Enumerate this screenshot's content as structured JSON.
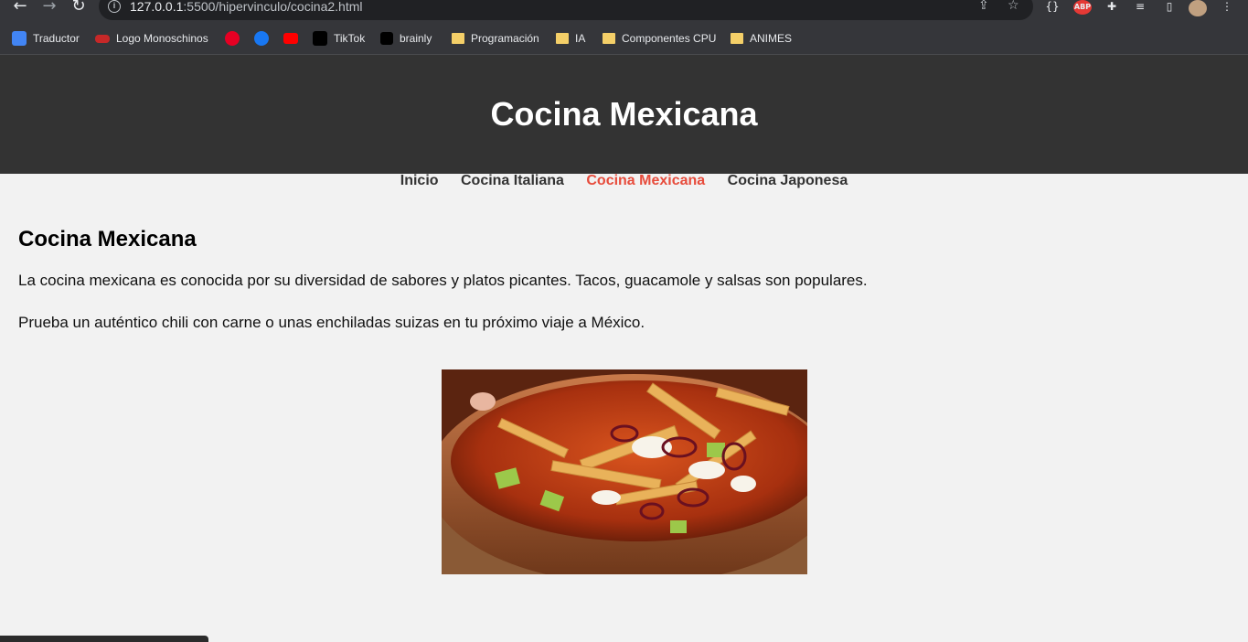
{
  "browser": {
    "url_host": "127.0.0.1",
    "url_rest": ":5500/hipervinculo/cocina2.html",
    "bookmarks": [
      {
        "label": "Traductor",
        "icon": "google-translate-icon"
      },
      {
        "label": "Logo Monoschinos",
        "icon": "monoschinos-icon"
      },
      {
        "label": "",
        "icon": "pinterest-icon"
      },
      {
        "label": "",
        "icon": "facebook-icon"
      },
      {
        "label": "",
        "icon": "youtube-icon"
      },
      {
        "label": "TikTok",
        "icon": "tiktok-icon"
      },
      {
        "label": "brainly",
        "icon": "brainly-icon"
      },
      {
        "label": "Programación",
        "icon": "folder-icon"
      },
      {
        "label": "IA",
        "icon": "folder-icon"
      },
      {
        "label": "Componentes CPU",
        "icon": "folder-icon"
      },
      {
        "label": "ANIMES",
        "icon": "folder-icon"
      }
    ],
    "extension_abp": "ABP"
  },
  "page": {
    "header_title": "Cocina Mexicana",
    "nav": [
      {
        "label": "Inicio",
        "active": false
      },
      {
        "label": "Cocina Italiana",
        "active": false
      },
      {
        "label": "Cocina Mexicana",
        "active": true
      },
      {
        "label": "Cocina Japonesa",
        "active": false
      }
    ],
    "heading": "Cocina Mexicana",
    "paragraphs": [
      "La cocina mexicana es conocida por su diversidad de sabores y platos picantes. Tacos, guacamole y salsas son populares.",
      "Prueba un auténtico chili con carne o unas enchiladas suizas en tu próximo viaje a México."
    ]
  },
  "colors": {
    "header_bg": "#333333",
    "nav_active": "#e74c3c",
    "page_bg": "#f2f2f2"
  }
}
